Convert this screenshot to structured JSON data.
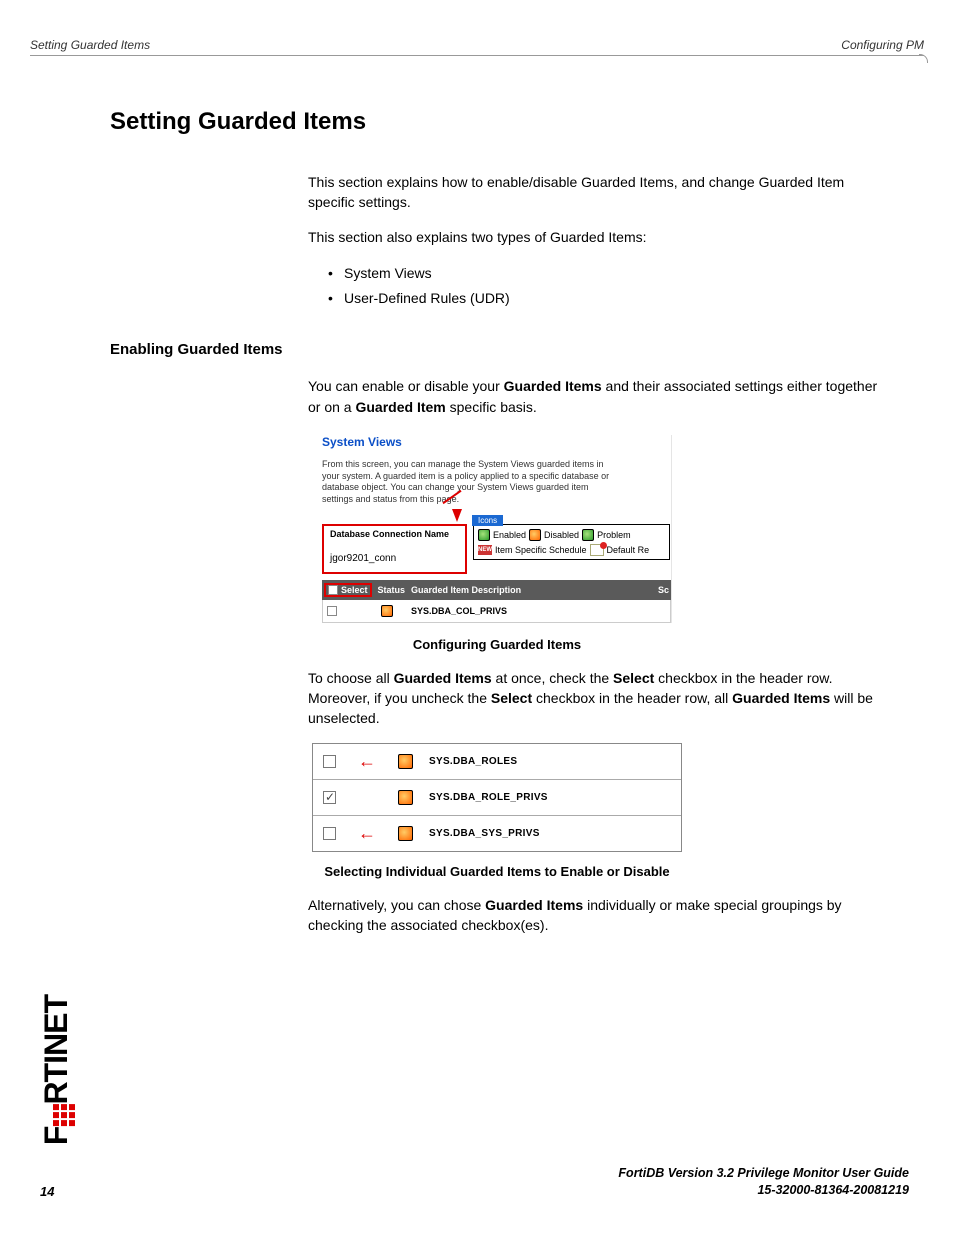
{
  "header": {
    "left": "Setting Guarded Items",
    "right": "Configuring PM"
  },
  "h1": "Setting Guarded Items",
  "intro1": "This section explains how to enable/disable Guarded Items, and change Guarded Item specific settings.",
  "intro2": "This section also explains two types of Guarded Items:",
  "bullets": {
    "a": "System Views",
    "b": "User-Defined Rules (UDR)"
  },
  "h2": "Enabling Guarded Items",
  "enable_p_pre": "You can enable or disable your ",
  "enable_p_b1": "Guarded Items",
  "enable_p_mid": " and their associated settings either together or on a ",
  "enable_p_b2": "Guarded Item",
  "enable_p_post": " specific basis.",
  "fig1": {
    "title": "System Views",
    "desc": "From this screen, you can manage the System Views guarded items in your system. A guarded item is a policy applied to a specific database or database object. You can change your System Views guarded item settings and status from this page.",
    "dbconn_label": "Database Connection Name",
    "dbconn_value": "jgor9201_conn",
    "icons_label": "Icons",
    "legend": {
      "enabled": "Enabled",
      "disabled": "Disabled",
      "problem": "Problem",
      "itemspec": "Item Specific Schedule",
      "default": "Default Re"
    },
    "th": {
      "select": "Select",
      "status": "Status",
      "desc": "Guarded Item Description",
      "sc": "Sc"
    },
    "row_item": "SYS.DBA_COL_PRIVS"
  },
  "caption1": "Configuring Guarded Items",
  "choose_pre": "To choose all ",
  "choose_b1": "Guarded Items",
  "choose_mid1": " at once, check the ",
  "choose_b2": "Select",
  "choose_mid2": " checkbox in the header row. Moreover, if you uncheck the ",
  "choose_b3": "Select",
  "choose_mid3": " checkbox in the header row, all ",
  "choose_b4": "Guarded Items",
  "choose_post": " will be unselected.",
  "fig2": {
    "r1": "SYS.DBA_ROLES",
    "r2": "SYS.DBA_ROLE_PRIVS",
    "r3": "SYS.DBA_SYS_PRIVS"
  },
  "caption2": "Selecting Individual Guarded Items to Enable or Disable",
  "alt_pre": "Alternatively, you can chose ",
  "alt_b": "Guarded Items",
  "alt_post": " individually or make special groupings by checking the associated checkbox(es).",
  "brand": {
    "a": "F",
    "b": "RTINET"
  },
  "footer": {
    "line1": "FortiDB Version 3.2 Privilege Monitor  User Guide",
    "line2": "15-32000-81364-20081219"
  },
  "page": "14"
}
